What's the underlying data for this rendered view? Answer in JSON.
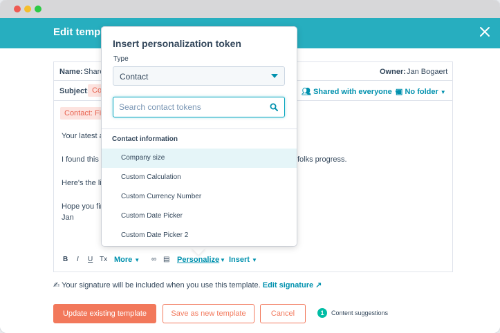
{
  "header": {
    "title": "Edit template"
  },
  "editor": {
    "name_label": "Name:",
    "name_value": "Share",
    "owner_label": "Owner:",
    "owner_value": "Jan Bogaert",
    "subject_label": "Subject:",
    "subject_token": "Co",
    "shared_label": "Shared with everyone",
    "folder_label": "No folder",
    "body_token": "Contact: Firs",
    "body_lines": [
      "Your latest ar",
      "I found this ar",
      "folks progress.",
      "Here's the lin",
      "Hope you find",
      "Jan"
    ]
  },
  "toolbar": {
    "bold": "B",
    "italic": "I",
    "underline": "U",
    "clear_format": "Tx",
    "more": "More",
    "personalize": "Personalize",
    "insert": "Insert"
  },
  "signature": {
    "note": "Your signature will be included when you use this template.",
    "edit_link": "Edit signature"
  },
  "buttons": {
    "update": "Update existing template",
    "save_new": "Save as new template",
    "cancel": "Cancel",
    "suggestions_count": "1",
    "suggestions_label": "Content suggestions"
  },
  "popover": {
    "title": "Insert personalization token",
    "type_label": "Type",
    "type_value": "Contact",
    "search_placeholder": "Search contact tokens",
    "section_label": "Contact information",
    "items": [
      {
        "label": "Company size",
        "active": true
      },
      {
        "label": "Custom Calculation",
        "active": false
      },
      {
        "label": "Custom Currency Number",
        "active": false
      },
      {
        "label": "Custom Date Picker",
        "active": false
      },
      {
        "label": "Custom Date Picker 2",
        "active": false
      }
    ]
  },
  "colors": {
    "header": "#27aebf",
    "accent": "#0091ae",
    "primary_button": "#f2785b",
    "token_chip_bg": "#fde3df",
    "hover_row": "#e5f5f8",
    "badge": "#00bda5"
  }
}
